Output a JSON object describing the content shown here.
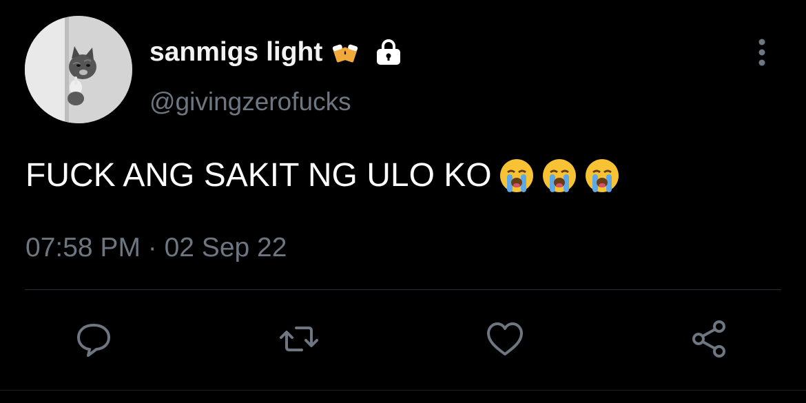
{
  "author": {
    "display_name": "sanmigs light",
    "name_emoji_icon": "beer-mugs-icon",
    "lock_icon": "lock-icon",
    "handle": "@givingzerofucks",
    "avatar_icon": "cat-avatar"
  },
  "tweet": {
    "text": "FUCK ANG SAKIT NG ULO KO",
    "emojis": [
      "loudly-crying-face-icon",
      "loudly-crying-face-icon",
      "loudly-crying-face-icon"
    ],
    "timestamp": "07:58 PM · 02 Sep 22"
  },
  "actions": [
    "reply-icon",
    "retweet-icon",
    "like-icon",
    "share-icon"
  ],
  "colors": {
    "background": "#000000",
    "text": "#ffffff",
    "secondary": "#6e7681",
    "divider": "#2b2f33"
  }
}
